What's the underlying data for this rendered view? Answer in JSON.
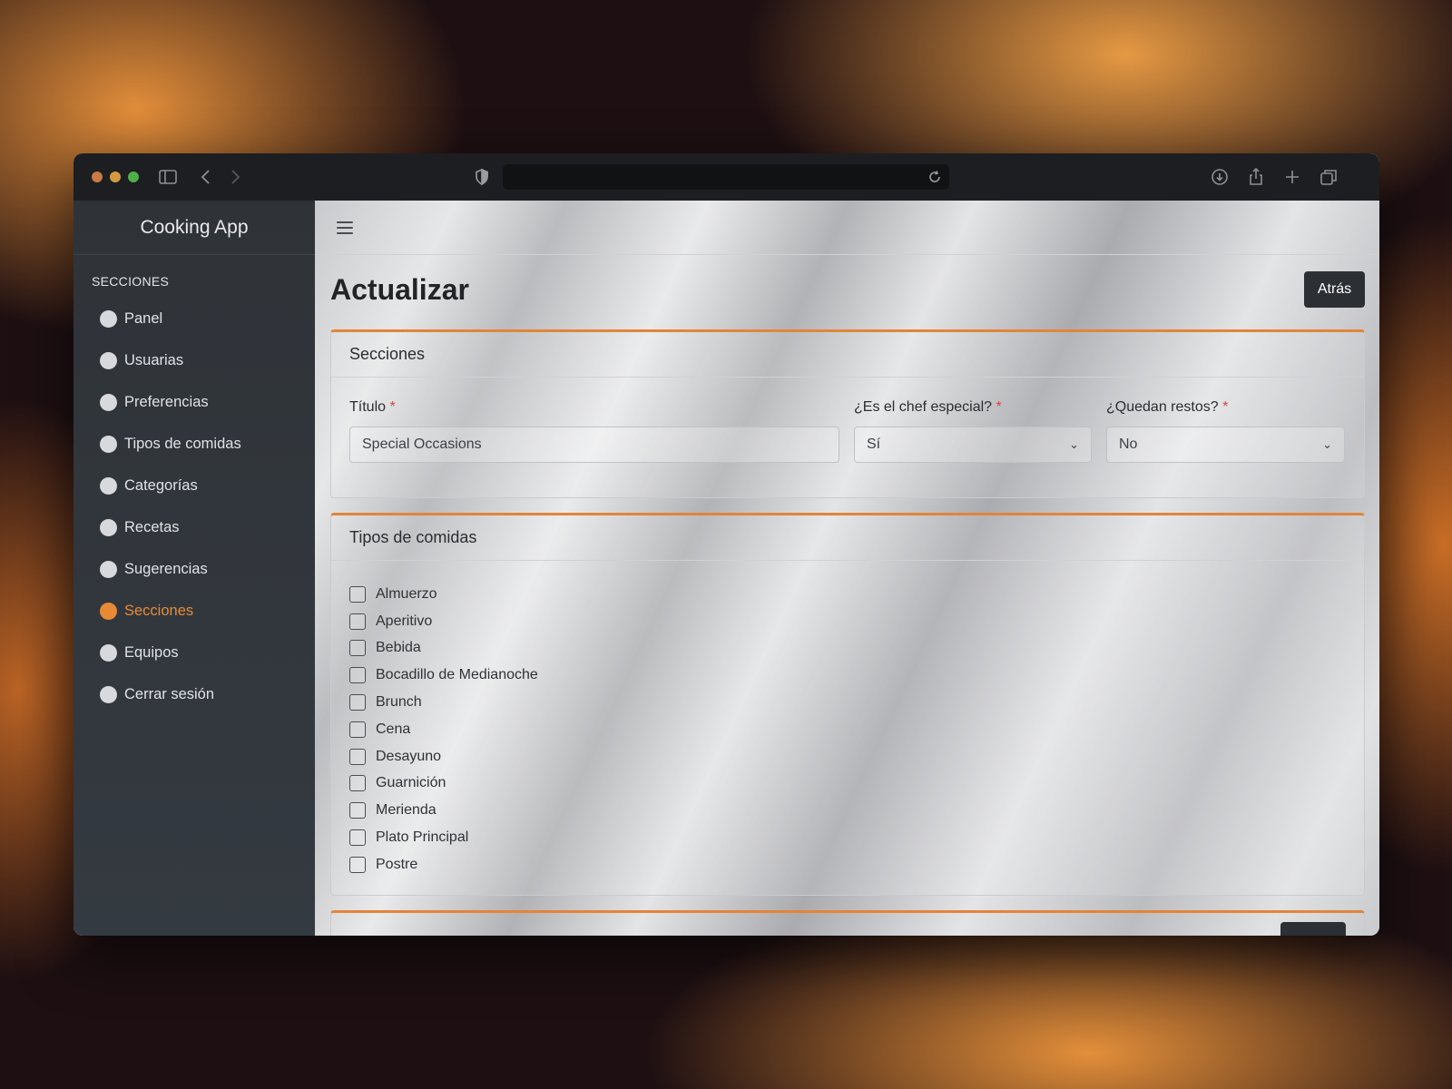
{
  "browser": {
    "traffic_lights": [
      "#c87a45",
      "#d39a3f",
      "#4fae4a"
    ],
    "address": ""
  },
  "sidebar": {
    "brand": "Cooking App",
    "section_title": "SECCIONES",
    "items": [
      {
        "label": "Panel",
        "active": false
      },
      {
        "label": "Usuarias",
        "active": false
      },
      {
        "label": "Preferencias",
        "active": false
      },
      {
        "label": "Tipos de comidas",
        "active": false
      },
      {
        "label": "Categorías",
        "active": false
      },
      {
        "label": "Recetas",
        "active": false
      },
      {
        "label": "Sugerencias",
        "active": false
      },
      {
        "label": "Secciones",
        "active": true
      },
      {
        "label": "Equipos",
        "active": false
      },
      {
        "label": "Cerrar sesión",
        "active": false
      }
    ]
  },
  "page": {
    "title": "Actualizar",
    "back_label": "Atrás"
  },
  "section_card": {
    "header": "Secciones",
    "fields": {
      "title_label": "Título",
      "title_value": "Special Occasions",
      "chef_label": "¿Es el chef especial?",
      "chef_value": "Sí",
      "leftovers_label": "¿Quedan restos?",
      "leftovers_value": "No",
      "required_mark": "*"
    }
  },
  "meal_types_card": {
    "header": "Tipos de comidas",
    "options": [
      "Almuerzo",
      "Aperitivo",
      "Bebida",
      "Bocadillo de Medianoche",
      "Brunch",
      "Cena",
      "Desayuno",
      "Guarnición",
      "Merienda",
      "Plato Principal",
      "Postre"
    ]
  },
  "colors": {
    "accent": "#e88a35",
    "sidebar_bg": "#31353b",
    "button_dark": "#2c2f33"
  }
}
